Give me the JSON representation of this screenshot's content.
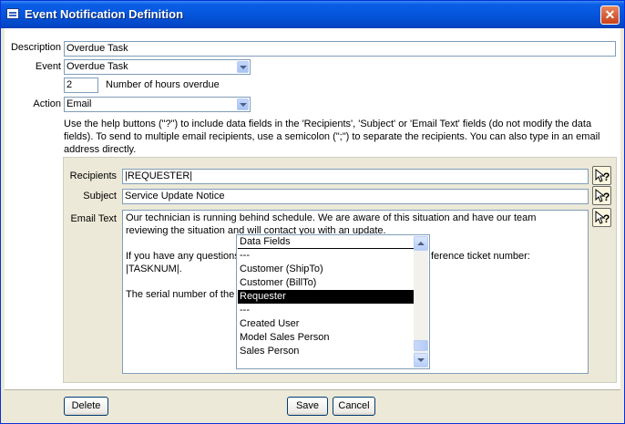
{
  "window": {
    "title": "Event Notification Definition",
    "close_label": "✕"
  },
  "form": {
    "description_label": "Description",
    "description_value": "Overdue Task",
    "event_label": "Event",
    "event_value": "Overdue Task",
    "hours_value": "2",
    "hours_label": "Number of hours overdue",
    "action_label": "Action",
    "action_value": "Email",
    "help_line1": "Use the help buttons (\"?\") to include data fields in the 'Recipients', 'Subject' or 'Email Text' fields (do not modify the data",
    "help_line2": "fields).  To send to multiple email recipients, use a semicolon (\";\") to separate the recipients.  You can also type in an email",
    "help_line3": "address directly."
  },
  "email": {
    "recipients_label": "Recipients",
    "recipients_value": "|REQUESTER|",
    "subject_label": "Subject",
    "subject_value": "Service Update Notice",
    "text_label": "Email Text",
    "text_line1": "Our technician is running behind schedule.  We are aware of this situation and have our team",
    "text_line2": "reviewing the situation and will contact you with an update.",
    "text_line3_a": "If you have any questions",
    "text_line3_b": "ference ticket number:",
    "text_line4": "|TASKNUM|.",
    "text_line5": "The serial number of the e"
  },
  "dropdown": {
    "items": [
      "Data Fields",
      "---",
      "Customer (ShipTo)",
      "Customer (BillTo)",
      "Requester",
      "---",
      "Created User",
      "Model Sales Person",
      "Sales Person"
    ],
    "selected": "Requester"
  },
  "buttons": {
    "delete": "Delete",
    "save": "Save",
    "cancel": "Cancel"
  },
  "colors": {
    "titlebar": "#0555dc",
    "window_bg": "#ece9d8",
    "selection": "#000000"
  }
}
